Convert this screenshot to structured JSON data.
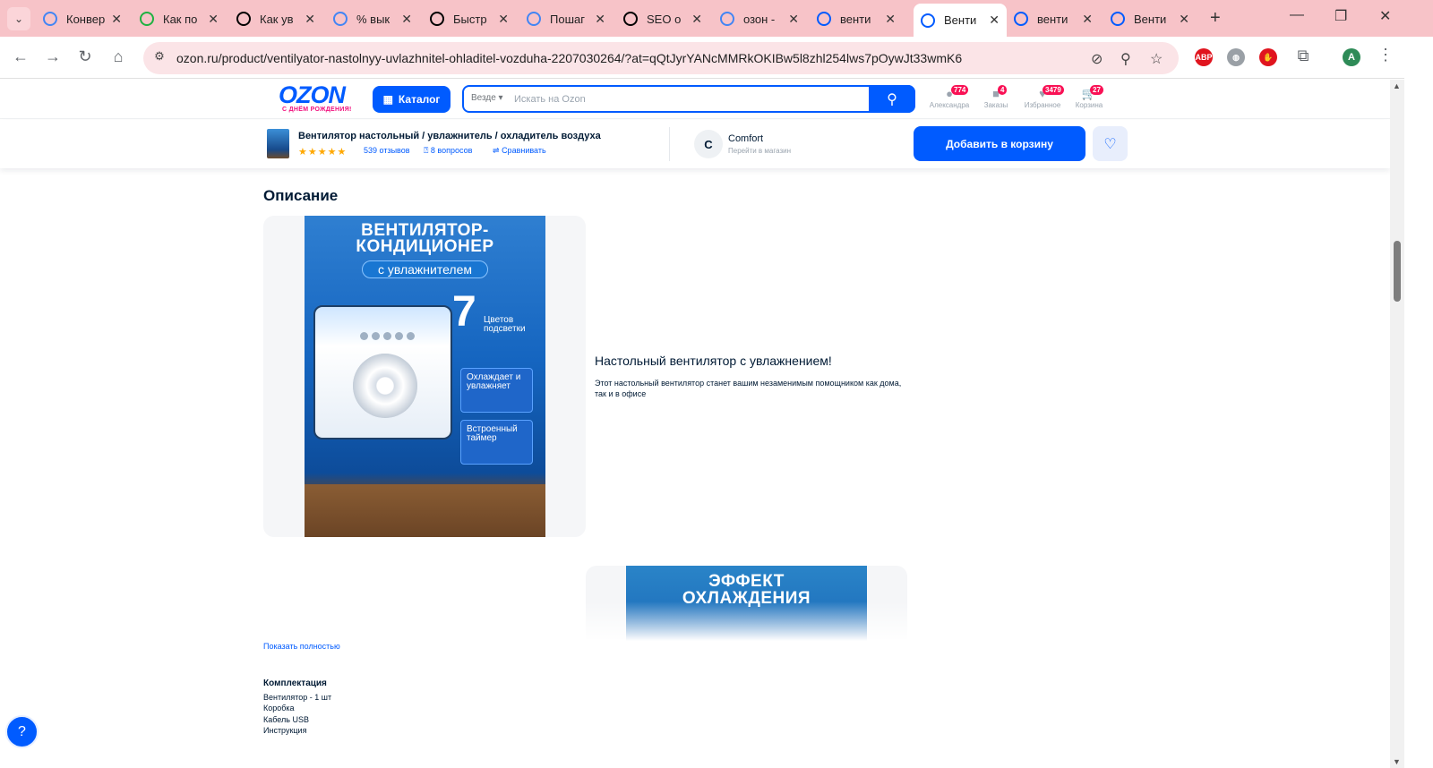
{
  "browser": {
    "tabs": [
      {
        "title": "Конвер",
        "favicon": "google-icon",
        "color": "#4285f4"
      },
      {
        "title": "Как по",
        "favicon": "play-icon",
        "color": "#1fb141"
      },
      {
        "title": "Как ув",
        "favicon": "ring-icon",
        "color": "#000000"
      },
      {
        "title": "% вык",
        "favicon": "google-icon",
        "color": "#4285f4"
      },
      {
        "title": "Быстр",
        "favicon": "ring-icon",
        "color": "#000000"
      },
      {
        "title": "Пошаг",
        "favicon": "google-icon",
        "color": "#4285f4"
      },
      {
        "title": "SEO о",
        "favicon": "w-icon",
        "color": "#000000"
      },
      {
        "title": "озон -",
        "favicon": "google-icon",
        "color": "#4285f4"
      },
      {
        "title": "венти",
        "favicon": "ozon-icon",
        "color": "#005bff"
      },
      {
        "title": "Венти",
        "favicon": "ozon-icon",
        "color": "#005bff"
      },
      {
        "title": "венти",
        "favicon": "ozon-icon",
        "color": "#005bff"
      },
      {
        "title": "Венти",
        "favicon": "ozon-icon",
        "color": "#005bff"
      }
    ],
    "active_tab_index": 9,
    "url": "ozon.ru/product/ventilyator-nastolnyy-uvlazhnitel-ohladitel-vozduha-2207030264/?at=qQtJyrYANcMMRkOKIBw5l8zhl254lws7pOywJt33wmK6",
    "profile_initial": "A",
    "extensions": [
      {
        "name": "adblock-icon",
        "label": "ABP",
        "color": "#e0141e"
      },
      {
        "name": "globe-icon",
        "label": "",
        "color": "#9aa0a6"
      },
      {
        "name": "hand-icon",
        "label": "",
        "color": "#e0141e"
      }
    ]
  },
  "header": {
    "logo": "OZON",
    "logo_sub": "С ДНЁМ РОЖДЕНИЯ!",
    "catalog_label": "Каталог",
    "search_scope": "Везде",
    "search_placeholder": "Искать на Ozon",
    "nav": [
      {
        "label": "Александра",
        "badge": "774",
        "icon": "user-icon"
      },
      {
        "label": "Заказы",
        "badge": "4",
        "icon": "box-icon"
      },
      {
        "label": "Избранное",
        "badge": "3479",
        "icon": "heart-icon"
      },
      {
        "label": "Корзина",
        "badge": "27",
        "icon": "cart-icon"
      }
    ]
  },
  "product_bar": {
    "title": "Вентилятор настольный / увлажнитель / охладитель воздуха",
    "reviews": "539 отзывов",
    "questions": "8 вопросов",
    "compare": "Сравнивать",
    "rating_stars": 5,
    "seller_initial": "C",
    "seller_name": "Comfort",
    "seller_link": "Перейти в магазин",
    "add_to_cart": "Добавить в корзину"
  },
  "description": {
    "heading": "Описание",
    "promo1": {
      "headline_1": "ВЕНТИЛЯТОР-",
      "headline_2": "КОНДИЦИОНЕР",
      "pill": "с увлажнителем",
      "seven": "7",
      "seven_label_1": "Цветов",
      "seven_label_2": "подсветки",
      "card1": "Охлаждает и увлажняет",
      "card2": "Встроенный таймер"
    },
    "intro_title": "Настольный вентилятор с увлажнением!",
    "intro_text": "Этот настольный вентилятор станет вашим незаменимым помощником как дома, так и в офисе",
    "promo2": {
      "headline_1": "ЭФФЕКТ",
      "headline_2": "ОХЛАЖДЕНИЯ"
    },
    "show_more": "Показать полностью"
  },
  "kit": {
    "title": "Комплектация",
    "items": [
      "Вентилятор - 1 шт",
      "Коробка",
      "Кабель USB",
      "Инструкция"
    ]
  }
}
